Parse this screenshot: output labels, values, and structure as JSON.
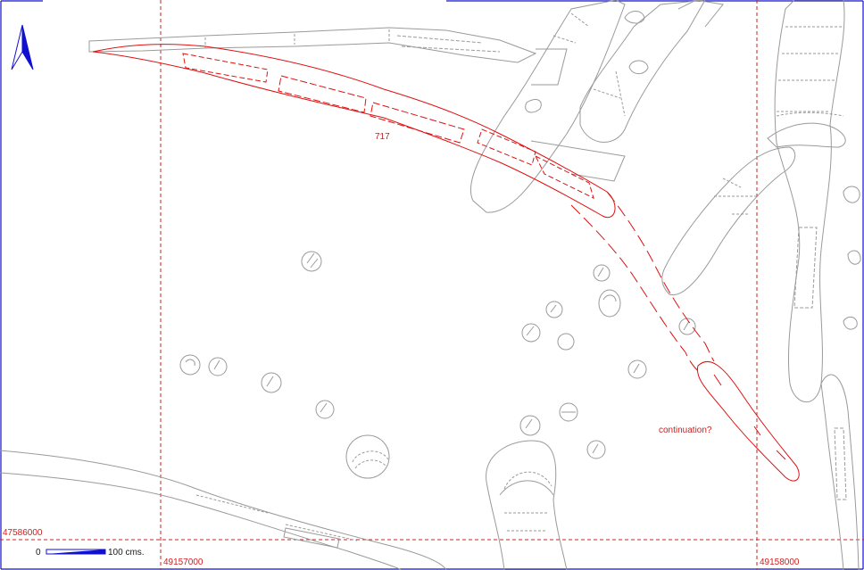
{
  "map": {
    "feature_label": "717",
    "continuation_label": "continuation?",
    "grid": {
      "northing": "47586000",
      "easting_left": "49157000",
      "easting_right": "49158000"
    },
    "scale": {
      "start": "0",
      "end": "100 cms."
    },
    "colors": {
      "frame": "#1010d0",
      "grid": "#cc2020",
      "feature": "#e01010",
      "features_grey": "#9a9a9a",
      "north_arrow": "#1010d0"
    },
    "north_icon": "north-arrow-icon"
  }
}
